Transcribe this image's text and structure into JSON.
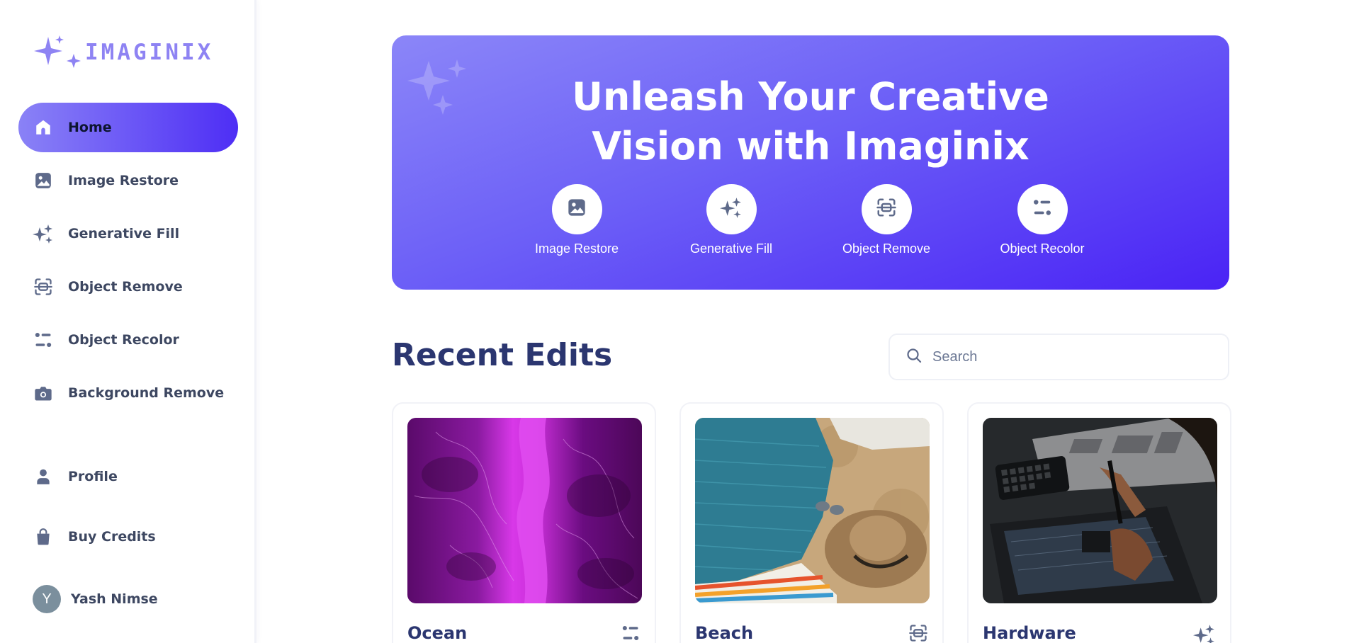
{
  "app": {
    "name": "IMAGINIX"
  },
  "sidebar": {
    "items": [
      {
        "label": "Home",
        "icon": "home-icon",
        "active": true
      },
      {
        "label": "Image Restore",
        "icon": "image-icon"
      },
      {
        "label": "Generative Fill",
        "icon": "sparkles-icon"
      },
      {
        "label": "Object Remove",
        "icon": "scan-icon"
      },
      {
        "label": "Object Recolor",
        "icon": "filter-icon"
      },
      {
        "label": "Background Remove",
        "icon": "camera-icon"
      }
    ],
    "bottom_items": [
      {
        "label": "Profile",
        "icon": "user-icon"
      },
      {
        "label": "Buy Credits",
        "icon": "bag-icon"
      }
    ],
    "user": {
      "initial": "Y",
      "name": "Yash Nimse"
    }
  },
  "hero": {
    "title_line1": "Unleash Your Creative",
    "title_line2": "Vision with Imaginix",
    "actions": [
      {
        "label": "Image Restore",
        "icon": "image-icon"
      },
      {
        "label": "Generative Fill",
        "icon": "sparkles-icon"
      },
      {
        "label": "Object Remove",
        "icon": "scan-icon"
      },
      {
        "label": "Object Recolor",
        "icon": "filter-icon"
      }
    ]
  },
  "recent": {
    "title": "Recent Edits",
    "search_placeholder": "Search",
    "cards": [
      {
        "title": "Ocean",
        "icon": "filter-icon"
      },
      {
        "title": "Beach",
        "icon": "scan-icon"
      },
      {
        "title": "Hardware",
        "icon": "sparkles-icon"
      }
    ]
  },
  "colors": {
    "accent_start": "#8a82f6",
    "accent_end": "#4e2ef5",
    "heading": "#2b3670",
    "icon": "#5e6a8a"
  }
}
